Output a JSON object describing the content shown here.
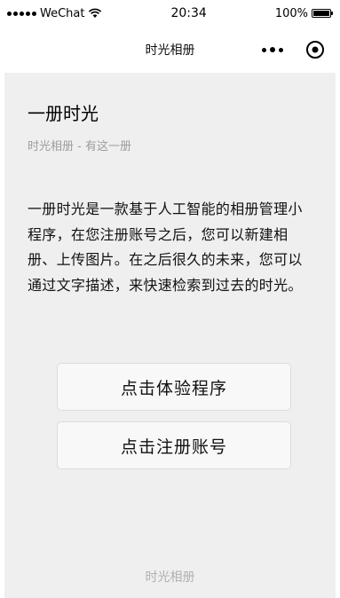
{
  "status_bar": {
    "carrier": "WeChat",
    "time": "20:34",
    "battery": "100%",
    "battery_level": 1.0,
    "icons": [
      "signal-icon",
      "wifi-icon",
      "battery-icon"
    ]
  },
  "nav": {
    "title": "时光相册",
    "icons": [
      "more-icon",
      "close-icon"
    ]
  },
  "main": {
    "title": "一册时光",
    "subtitle": "时光相册 - 有这一册",
    "description": "一册时光是一款基于人工智能的相册管理小程序，在您注册账号之后，您可以新建相册、上传图片。在之后很久的未来，您可以通过文字描述，来快速检索到过去的时光。",
    "buttons": {
      "experience": "点击体验程序",
      "register": "点击注册账号"
    }
  },
  "footer": {
    "text": "时光相册"
  },
  "colors": {
    "page_background": "#efefef",
    "bar_background": "#ffffff",
    "button_background": "#f8f8f8",
    "muted_text": "#9c9c9c"
  }
}
